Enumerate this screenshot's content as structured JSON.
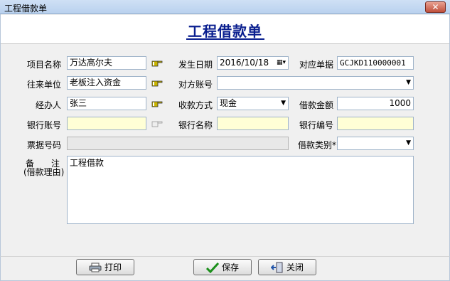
{
  "window": {
    "title": "工程借款单"
  },
  "form": {
    "title": "工程借款单",
    "fields": {
      "project_name": {
        "label": "项目名称",
        "value": "万达高尔夫"
      },
      "date": {
        "label": "发生日期",
        "value": "2016/10/18"
      },
      "doc_no": {
        "label": "对应单据",
        "value": "GCJKD110000001"
      },
      "partner": {
        "label": "往来单位",
        "value": "老板注入资金"
      },
      "counter_account": {
        "label": "对方账号",
        "value": ""
      },
      "handler": {
        "label": "经办人",
        "value": "张三"
      },
      "pay_method": {
        "label": "收款方式",
        "value": "现金"
      },
      "amount": {
        "label": "借款金额",
        "value": "1000"
      },
      "bank_account": {
        "label": "银行账号",
        "value": ""
      },
      "bank_name": {
        "label": "银行名称",
        "value": ""
      },
      "bank_code": {
        "label": "银行编号",
        "value": ""
      },
      "ticket_no": {
        "label": "票据号码",
        "value": ""
      },
      "loan_type": {
        "label": "借款类别*",
        "value": ""
      },
      "remark": {
        "label_line1": "备　　注",
        "label_line2": "(借款理由)",
        "value": "工程借款"
      }
    }
  },
  "buttons": {
    "print": "打印",
    "save": "保存",
    "close": "关闭"
  },
  "colors": {
    "title": "#0a1f8f",
    "highlight_field": "#ffffd6"
  }
}
